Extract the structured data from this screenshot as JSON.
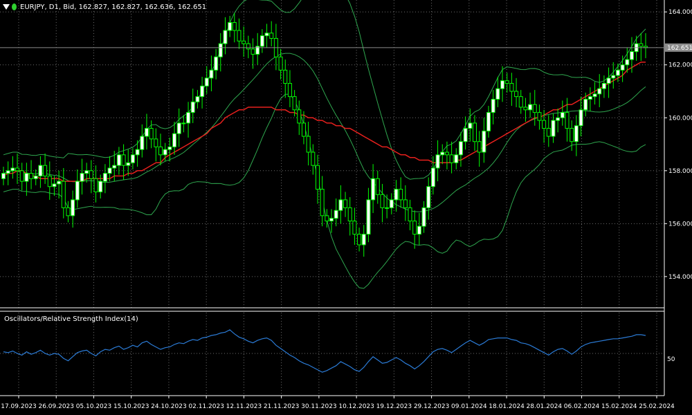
{
  "header": {
    "title": "EURJPY, D1, Bid, 162.827, 162.827, 162.636, 162.651"
  },
  "indicator": {
    "label": "Oscillators/Relative Strength Index(14)",
    "level_label": "50"
  },
  "colors": {
    "background": "#000000",
    "grid": "#c8c8c8",
    "bull_body": "#ffffff",
    "bear_body": "#000000",
    "candle_outline": "#00ff00",
    "bollinger": "#2fa84f",
    "ma": "#e8201d",
    "rsi": "#2b7bd6",
    "price_line": "#8c8c8c"
  },
  "chart_data": {
    "type": "candlestick",
    "symbol": "EURJPY",
    "timeframe": "D1",
    "current_price": 162.651,
    "current_price_label": "162.651",
    "y_ticks": [
      164.0,
      162.0,
      160.0,
      158.0,
      156.0,
      154.0
    ],
    "y_tick_labels": [
      "164.000",
      "162.000",
      "160.000",
      "158.000",
      "156.000",
      "154.000"
    ],
    "ylim": [
      152.82,
      164.45
    ],
    "x_tick_labels": [
      "17.09.2023",
      "26.09.2023",
      "05.10.2023",
      "15.10.2023",
      "24.10.2023",
      "02.11.2023",
      "12.11.2023",
      "21.11.2023",
      "30.11.2023",
      "10.12.2023",
      "19.12.2023",
      "29.12.2023",
      "09.01.2024",
      "18.01.2024",
      "28.01.2024",
      "06.02.2024",
      "15.02.2024",
      "25.02.2024"
    ],
    "candles_close": [
      157.9,
      158.0,
      158.1,
      158.0,
      157.6,
      157.9,
      157.7,
      157.8,
      158.2,
      157.8,
      157.4,
      157.5,
      157.6,
      156.6,
      156.3,
      156.9,
      157.6,
      157.9,
      158.0,
      157.7,
      157.2,
      157.6,
      157.9,
      158.1,
      158.2,
      158.6,
      158.2,
      158.3,
      158.6,
      158.8,
      159.3,
      159.6,
      159.2,
      158.9,
      158.6,
      158.8,
      158.9,
      159.4,
      159.8,
      159.8,
      160.2,
      160.6,
      160.8,
      161.2,
      161.5,
      161.8,
      162.3,
      162.8,
      163.3,
      163.6,
      163.3,
      162.9,
      162.8,
      162.6,
      162.4,
      162.7,
      163.1,
      163.2,
      163.0,
      162.3,
      161.8,
      161.3,
      160.8,
      160.3,
      159.8,
      159.3,
      158.7,
      158.2,
      157.3,
      156.3,
      156.1,
      156.2,
      156.5,
      156.9,
      156.6,
      156.1,
      155.6,
      155.2,
      155.6,
      156.9,
      157.7,
      157.1,
      156.6,
      156.6,
      156.9,
      157.3,
      156.9,
      156.6,
      156.1,
      155.6,
      155.9,
      156.6,
      157.4,
      158.1,
      158.6,
      158.7,
      158.6,
      158.3,
      158.6,
      159.1,
      159.6,
      159.8,
      159.1,
      158.7,
      159.5,
      160.2,
      160.7,
      161.1,
      161.4,
      161.3,
      161.0,
      160.8,
      160.4,
      160.3,
      160.5,
      160.2,
      159.9,
      159.6,
      159.3,
      159.9,
      160.0,
      160.2,
      159.6,
      159.1,
      159.7,
      160.3,
      160.7,
      160.8,
      160.9,
      161.1,
      161.3,
      161.5,
      161.6,
      161.8,
      162.0,
      162.2,
      162.5,
      162.8,
      162.7,
      162.651
    ],
    "rsi": [
      52,
      51,
      53,
      50,
      48,
      52,
      49,
      51,
      54,
      50,
      48,
      50,
      49,
      44,
      41,
      46,
      51,
      53,
      54,
      50,
      47,
      52,
      55,
      54,
      57,
      59,
      55,
      57,
      60,
      58,
      63,
      65,
      61,
      58,
      55,
      57,
      58,
      61,
      63,
      62,
      65,
      67,
      66,
      69,
      70,
      72,
      73,
      75,
      76,
      79,
      74,
      70,
      68,
      65,
      63,
      66,
      68,
      69,
      66,
      60,
      56,
      52,
      48,
      45,
      41,
      38,
      36,
      33,
      30,
      27,
      29,
      32,
      35,
      40,
      37,
      34,
      30,
      28,
      33,
      40,
      46,
      42,
      38,
      39,
      42,
      45,
      42,
      38,
      35,
      31,
      35,
      40,
      46,
      52,
      55,
      56,
      54,
      51,
      55,
      59,
      63,
      66,
      63,
      60,
      63,
      67,
      68,
      69,
      69,
      69,
      67,
      66,
      63,
      62,
      60,
      57,
      54,
      51,
      48,
      52,
      55,
      56,
      53,
      49,
      53,
      58,
      61,
      63,
      64,
      65,
      66,
      67,
      68,
      68,
      69,
      70,
      71,
      73,
      73,
      72
    ],
    "ma_series": [
      157.8,
      157.9,
      157.9,
      158.0,
      158.0,
      157.9,
      157.8,
      157.8,
      157.7,
      157.7,
      157.7,
      157.7,
      157.7,
      157.6,
      157.6,
      157.6,
      157.6,
      157.6,
      157.7,
      157.7,
      157.7,
      157.7,
      157.7,
      157.7,
      157.8,
      157.8,
      157.8,
      157.9,
      157.9,
      158.0,
      158.0,
      158.1,
      158.2,
      158.3,
      158.3,
      158.5,
      158.6,
      158.7,
      158.8,
      158.9,
      159.0,
      159.1,
      159.2,
      159.3,
      159.4,
      159.6,
      159.7,
      159.8,
      160.0,
      160.1,
      160.2,
      160.3,
      160.3,
      160.4,
      160.4,
      160.4,
      160.4,
      160.4,
      160.4,
      160.3,
      160.3,
      160.3,
      160.2,
      160.2,
      160.1,
      160.1,
      160.0,
      160.0,
      159.9,
      159.9,
      159.8,
      159.8,
      159.7,
      159.7,
      159.6,
      159.6,
      159.5,
      159.4,
      159.3,
      159.2,
      159.1,
      159.0,
      158.9,
      158.9,
      158.8,
      158.7,
      158.6,
      158.6,
      158.5,
      158.5,
      158.4,
      158.4,
      158.4,
      158.3,
      158.3,
      158.3,
      158.3,
      158.3,
      158.4,
      158.4,
      158.5,
      158.6,
      158.7,
      158.8,
      158.9,
      159.0,
      159.1,
      159.2,
      159.3,
      159.4,
      159.5,
      159.6,
      159.7,
      159.8,
      159.9,
      160.0,
      160.0,
      160.1,
      160.2,
      160.3,
      160.3,
      160.4,
      160.5,
      160.5,
      160.6,
      160.7,
      160.8,
      160.9,
      161.0,
      161.1,
      161.2,
      161.3,
      161.4,
      161.5,
      161.6,
      161.8,
      161.9,
      162.0,
      162.1,
      162.1
    ],
    "ma_label": "MA",
    "bollinger_bands": "upper/middle/lower (20,2)"
  }
}
